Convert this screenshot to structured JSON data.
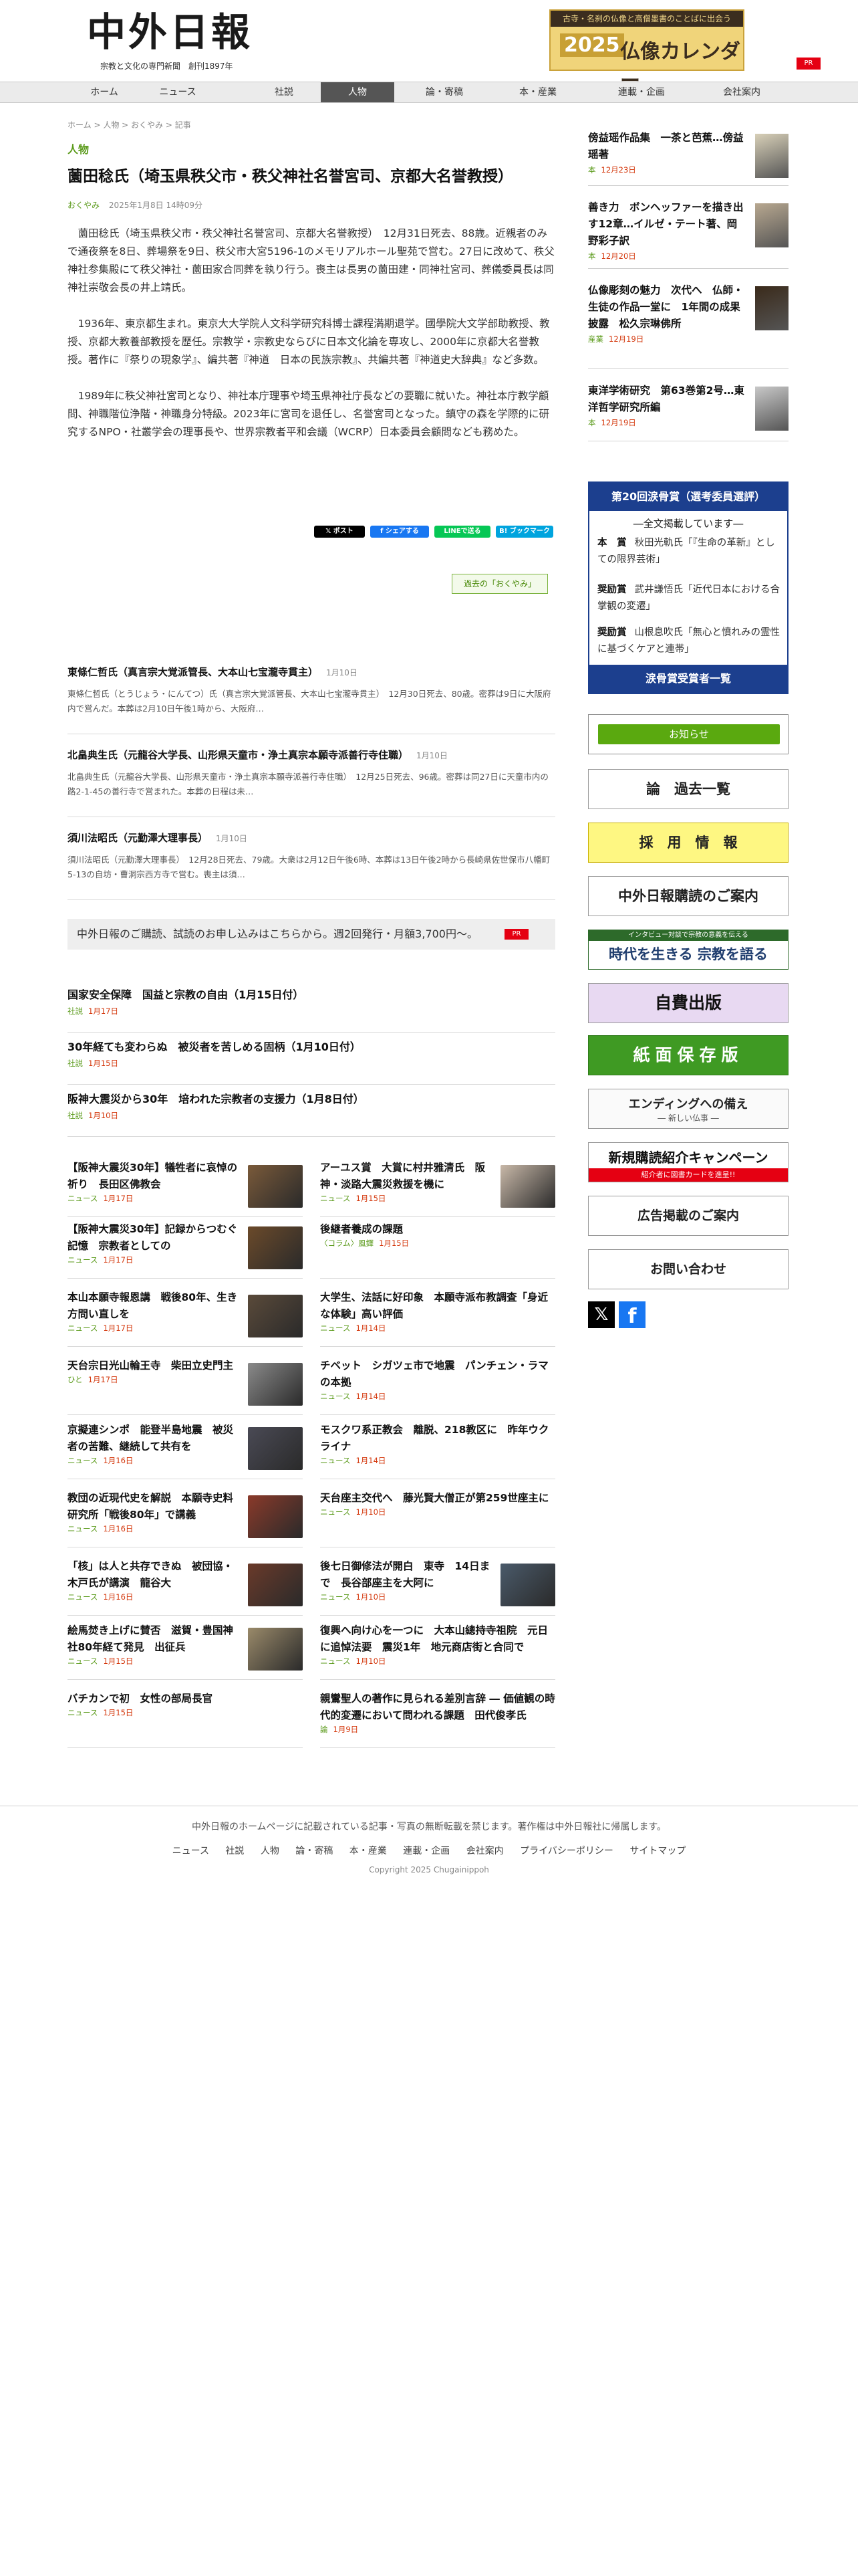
{
  "header": {
    "logo": "中外日報",
    "tagline": "宗教と文化の専門新聞　創刊1897年",
    "banner": {
      "top": "古寺・名刹の仏像と高僧墨書のことばに出会う",
      "year": "2025",
      "main": "仏像カレンダー",
      "pr": "PR"
    }
  },
  "nav": [
    "ホーム",
    "ニュース",
    "社説",
    "人物",
    "論・寄稿",
    "本・産業",
    "連載・企画",
    "会社案内"
  ],
  "breadcrumb": [
    "ホーム",
    "人物",
    "おくやみ",
    "記事"
  ],
  "category": "人物",
  "article": {
    "title": "薗田稔氏（埼玉県秩父市・秩父神社名誉宮司、京都大名誉教授）",
    "meta_category": "おくやみ",
    "meta_date": "2025年1月8日 14時09分",
    "paragraphs": [
      "薗田稔氏（埼玉県秩父市・秩父神社名誉宮司、京都大名誉教授）　12月31日死去、88歳。近親者のみで通夜祭を8日、葬場祭を9日、秩父市大宮5196-1のメモリアルホール聖苑で営む。27日に改めて、秩父神社参集殿にて秩父神社・薗田家合同葬を執り行う。喪主は長男の薗田建・同神社宮司、葬儀委員長は同神社崇敬会長の井上靖氏。",
      "1936年、東京都生まれ。東京大大学院人文科学研究科博士課程満期退学。國學院大文学部助教授、教授、京都大教養部教授を歴任。宗教学・宗教史ならびに日本文化論を専攻し、2000年に京都大名誉教授。著作に『祭りの現象学』、編共著『神道　日本の民族宗教』、共編共著『神道史大辞典』など多数。",
      "1989年に秩父神社宮司となり、神社本庁理事や埼玉県神社庁長などの要職に就いた。神社本庁教学顧問、神職階位浄階・神職身分特級。2023年に宮司を退任し、名誉宮司となった。鎮守の森を学際的に研究するNPO・社叢学会の理事長や、世界宗教者平和会議（WCRP）日本委員会顧問なども務めた。"
    ],
    "share": [
      "𝕏 ポスト",
      "f シェアする",
      "LINEで送る",
      "B! ブックマーク"
    ],
    "related_link": "過去の「おくやみ」"
  },
  "obituaries": [
    {
      "title": "東條仁哲氏（真言宗大覚派管長、大本山七宝瀧寺貫主）",
      "date": "1月10日",
      "text": "東條仁哲氏（とうじょう・にんてつ）氏（真言宗大覚派管長、大本山七宝瀧寺貫主）　12月30日死去、80歳。密葬は9日に大阪府内で営んだ。本葬は2月10日午後1時から、大阪府…"
    },
    {
      "title": "北畠典生氏（元龍谷大学長、山形県天童市・浄土真宗本願寺派善行寺住職）",
      "date": "1月10日",
      "text": "北畠典生氏（元龍谷大学長、山形県天童市・浄土真宗本願寺派善行寺住職）　12月25日死去、96歳。密葬は同27日に天童市内の路2-1-45の善行寺で営まれた。本葬の日程は未…"
    },
    {
      "title": "須川法昭氏（元勤澤大理事長）",
      "date": "1月10日",
      "text": "須川法昭氏（元勤澤大理事長）　12月28日死去、79歳。大衆は2月12日午後6時、本葬は13日午後2時から長崎県佐世保市八幡町5-13の自坊・曹洞宗西方寺で営む。喪主は須…"
    }
  ],
  "subscribe": {
    "text": "中外日報のご購読、試読のお申し込みはこちらから。週2回発行・月額3,700円〜。",
    "pr": "PR"
  },
  "features": [
    {
      "title": "国家安全保障　国益と宗教の自由（1月15日付）",
      "category": "社説",
      "date": "1月17日"
    },
    {
      "title": "30年経ても変わらぬ　被災者を苦しめる固柄（1月10日付）",
      "category": "社説",
      "date": "1月15日"
    },
    {
      "title": "阪神大震災から30年　培われた宗教者の支援力（1月8日付）",
      "category": "社説",
      "date": "1月10日"
    }
  ],
  "grid_left": [
    {
      "title": "【阪神大震災30年】犠牲者に哀悼の祈り　長田区佛教会",
      "category": "ニュース",
      "date": "1月17日"
    },
    {
      "title": "【阪神大震災30年】記録からつむぐ記憶　宗教者としての",
      "category": "ニュース",
      "date": "1月17日"
    },
    {
      "title": "本山本願寺報恩講　戦後80年、生き方問い直しを",
      "category": "ニュース",
      "date": "1月17日"
    },
    {
      "title": "天台宗日光山輪王寺　柴田立史門主",
      "category": "ひと",
      "date": "1月17日"
    },
    {
      "title": "京擬連シンポ　能登半島地震　被災者の苦難、継続して共有を",
      "category": "ニュース",
      "date": "1月16日"
    },
    {
      "title": "教団の近現代史を解説　本願寺史料研究所「戦後80年」で講義",
      "category": "ニュース",
      "date": "1月16日"
    },
    {
      "title": "「核」は人と共存できぬ　被団協・木戸氏が講演　龍谷大",
      "category": "ニュース",
      "date": "1月16日"
    },
    {
      "title": "絵馬焚き上げに賛否　滋賀・豊国神社80年経て発見　出征兵",
      "category": "ニュース",
      "date": "1月15日"
    },
    {
      "title": "バチカンで初　女性の部局長官",
      "category": "ニュース",
      "date": "1月15日"
    }
  ],
  "grid_right": [
    {
      "title": "アーユス賞　大賞に村井雅清氏　阪神・淡路大震災救援を機に",
      "category": "ニュース",
      "date": "1月15日"
    },
    {
      "title": "後継者養成の課題",
      "category": "〈コラム〉風鐸",
      "date": "1月15日"
    },
    {
      "title": "大学生、法話に好印象　本願寺派布教調査「身近な体験」高い評価",
      "category": "ニュース",
      "date": "1月14日"
    },
    {
      "title": "チベット　シガツェ市で地震　パンチェン・ラマの本拠",
      "category": "ニュース",
      "date": "1月14日"
    },
    {
      "title": "モスクワ系正教会　離脱、218教区に　昨年ウクライナ",
      "category": "ニュース",
      "date": "1月14日"
    },
    {
      "title": "天台座主交代へ　藤光賢大僧正が第259世座主に",
      "category": "ニュース",
      "date": "1月10日"
    },
    {
      "title": "後七日御修法が開白　東寺　14日まで　長谷部座主を大阿に",
      "category": "ニュース",
      "date": "1月10日"
    },
    {
      "title": "復興へ向け心を一つに　大本山總持寺祖院　元日に追悼法要　震災1年　地元商店街と合同で",
      "category": "ニュース",
      "date": "1月10日"
    },
    {
      "title": "親鸞聖人の著作に見られる差別言辞 ― 価値観の時代的変遷において問われる課題　田代俊孝氏",
      "category": "論",
      "date": "1月9日"
    }
  ],
  "ranking": [
    {
      "title": "傍益瑶作品集　一茶と芭蕉…傍益瑶著",
      "category": "本",
      "date": "12月23日"
    },
    {
      "title": "善き力　ボンヘッファーを描き出す12章…イルゼ・テート著、岡野彩子訳",
      "category": "本",
      "date": "12月20日"
    },
    {
      "title": "仏像彫刻の魅力　次代へ　仏師・生徒の作品一堂に　1年間の成果披露　松久宗琳佛所",
      "category": "産業",
      "date": "12月19日"
    },
    {
      "title": "東洋学術研究　第63巻第2号…東洋哲学研究所編",
      "category": "本",
      "date": "12月19日"
    }
  ],
  "award": {
    "header": "第20回涙骨賞（選考委員選評）",
    "sub": "―全文掲載しています―",
    "rows": [
      {
        "label": "本　賞",
        "text": "秋田光軌氏「『生命の革新』としての限界芸術」"
      },
      {
        "label": "奨励賞",
        "text": "武井謙悟氏「近代日本における合掌観の変遷」"
      },
      {
        "label": "奨励賞",
        "text": "山根息吹氏「無心と憤れみの霊性に基づくケアと連帯」"
      }
    ],
    "footer": "涙骨賞受賞者一覧"
  },
  "sidebar_buttons": [
    "お知らせ",
    "論　過去一覧",
    "採　用　情　報",
    "中外日報購読のご案内",
    "時代を生きる 宗教を語る",
    "自費出版",
    "紙面保存版",
    "エンディングへの備え",
    "新規購読紹介キャンペーン",
    "広告掲載のご案内",
    "お問い合わせ"
  ],
  "sidebar_sub": {
    "ending": "― 新しい仏事 ―",
    "campaign": "紹介者に図書カードを進呈!!",
    "dialogue": "インタビュー対談で宗教の意義を伝える"
  },
  "footer": {
    "notice": "中外日報のホームページに記載されている記事・写真の無断転載を禁じます。著作権は中外日報社に帰属します。",
    "links": [
      "ニュース",
      "社説",
      "人物",
      "論・寄稿",
      "本・産業",
      "連載・企画",
      "会社案内",
      "プライバシーポリシー",
      "サイトマップ"
    ],
    "copyright": "Copyright 2025 Chugainippoh"
  },
  "colors": {
    "accent": "#5a9a1a",
    "date": "#d4380d",
    "award": "#1c3f8e",
    "pr": "#e50012"
  }
}
